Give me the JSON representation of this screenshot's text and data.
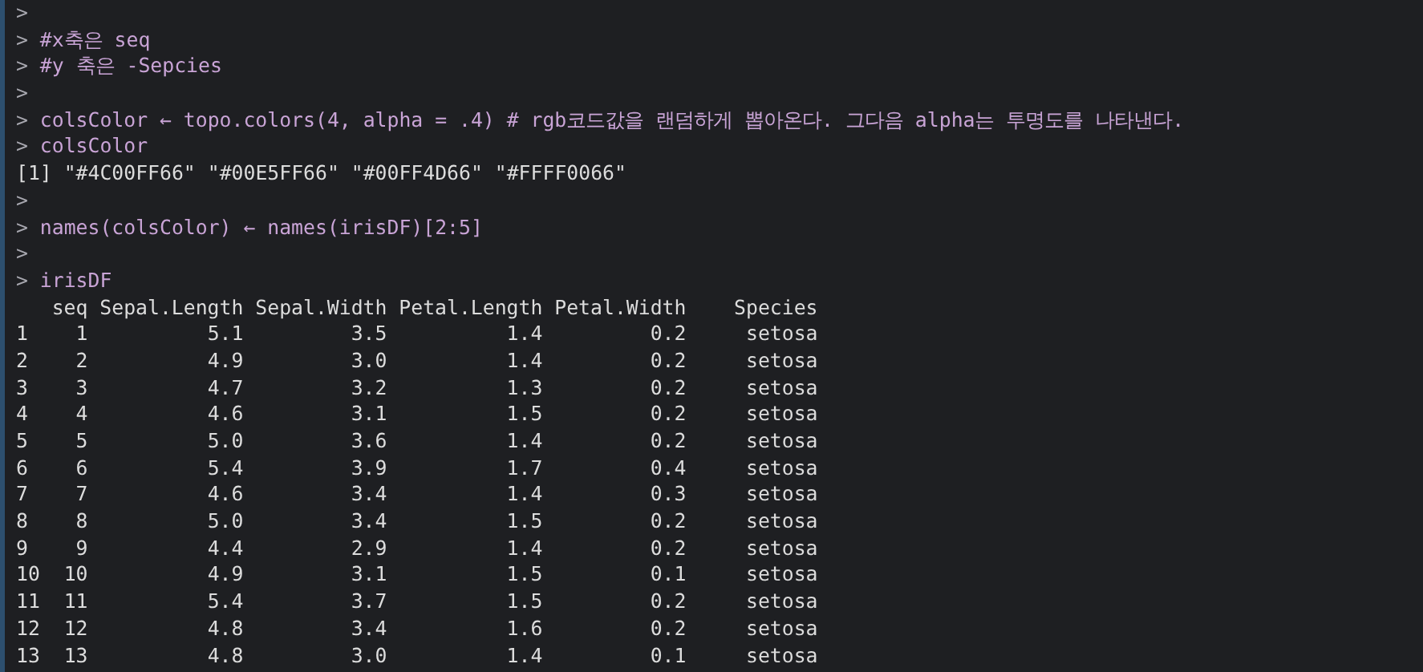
{
  "console": {
    "lines": [
      {
        "kind": "input",
        "prompt": ">"
      },
      {
        "kind": "input",
        "prompt": ">",
        "code": "#x축은 seq"
      },
      {
        "kind": "input",
        "prompt": ">",
        "code": "#y 축은 -Sepcies"
      },
      {
        "kind": "input",
        "prompt": ">"
      },
      {
        "kind": "input",
        "prompt": ">",
        "code": "colsColor ← topo.colors(4, alpha = .4) # rgb코드값을 랜덤하게 뽑아온다. 그다음 alpha는 투명도를 나타낸다."
      },
      {
        "kind": "input",
        "prompt": ">",
        "code": "colsColor"
      },
      {
        "kind": "output",
        "text": "[1] \"#4C00FF66\" \"#00E5FF66\" \"#00FF4D66\" \"#FFFF0066\""
      },
      {
        "kind": "input",
        "prompt": ">"
      },
      {
        "kind": "input",
        "prompt": ">",
        "code": "names(colsColor) ← names(irisDF)[2:5]"
      },
      {
        "kind": "input",
        "prompt": ">"
      },
      {
        "kind": "input",
        "prompt": ">",
        "code": "irisDF"
      }
    ],
    "table": {
      "columns": [
        null,
        "seq",
        "Sepal.Length",
        "Sepal.Width",
        "Petal.Length",
        "Petal.Width",
        "Species"
      ],
      "rows": [
        [
          "1",
          "1",
          "5.1",
          "3.5",
          "1.4",
          "0.2",
          "setosa"
        ],
        [
          "2",
          "2",
          "4.9",
          "3.0",
          "1.4",
          "0.2",
          "setosa"
        ],
        [
          "3",
          "3",
          "4.7",
          "3.2",
          "1.3",
          "0.2",
          "setosa"
        ],
        [
          "4",
          "4",
          "4.6",
          "3.1",
          "1.5",
          "0.2",
          "setosa"
        ],
        [
          "5",
          "5",
          "5.0",
          "3.6",
          "1.4",
          "0.2",
          "setosa"
        ],
        [
          "6",
          "6",
          "5.4",
          "3.9",
          "1.7",
          "0.4",
          "setosa"
        ],
        [
          "7",
          "7",
          "4.6",
          "3.4",
          "1.4",
          "0.3",
          "setosa"
        ],
        [
          "8",
          "8",
          "5.0",
          "3.4",
          "1.5",
          "0.2",
          "setosa"
        ],
        [
          "9",
          "9",
          "4.4",
          "2.9",
          "1.4",
          "0.2",
          "setosa"
        ],
        [
          "10",
          "10",
          "4.9",
          "3.1",
          "1.5",
          "0.1",
          "setosa"
        ],
        [
          "11",
          "11",
          "5.4",
          "3.7",
          "1.5",
          "0.2",
          "setosa"
        ],
        [
          "12",
          "12",
          "4.8",
          "3.4",
          "1.6",
          "0.2",
          "setosa"
        ],
        [
          "13",
          "13",
          "4.8",
          "3.0",
          "1.4",
          "0.1",
          "setosa"
        ]
      ]
    }
  }
}
